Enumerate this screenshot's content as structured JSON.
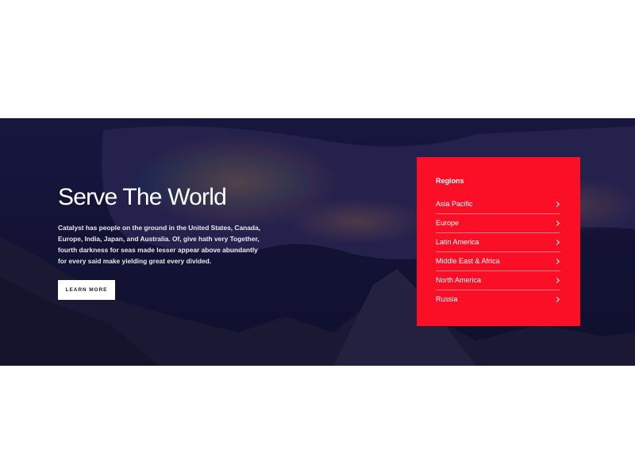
{
  "hero": {
    "title": "Serve The World",
    "description": "Catalyst has people on the ground in the United States, Canada, Europe, India, Japan, and Australia. Of, give hath very Together, fourth darkness for seas made lesser appear above abundantly for every said make yielding great every divided.",
    "button_label": "LEARN MORE",
    "background": "night-city-lake-mountains-photo"
  },
  "regions": {
    "title": "Regions",
    "accent_color": "#fa0f26",
    "items": [
      {
        "label": "Asia Pacific",
        "icon": "chevron-right-icon"
      },
      {
        "label": "Europe",
        "icon": "chevron-right-icon"
      },
      {
        "label": "Latin America",
        "icon": "chevron-right-icon"
      },
      {
        "label": "Middle East & Africa",
        "icon": "chevron-right-icon"
      },
      {
        "label": "North America",
        "icon": "chevron-right-icon"
      },
      {
        "label": "Russia",
        "icon": "chevron-right-icon"
      }
    ]
  }
}
